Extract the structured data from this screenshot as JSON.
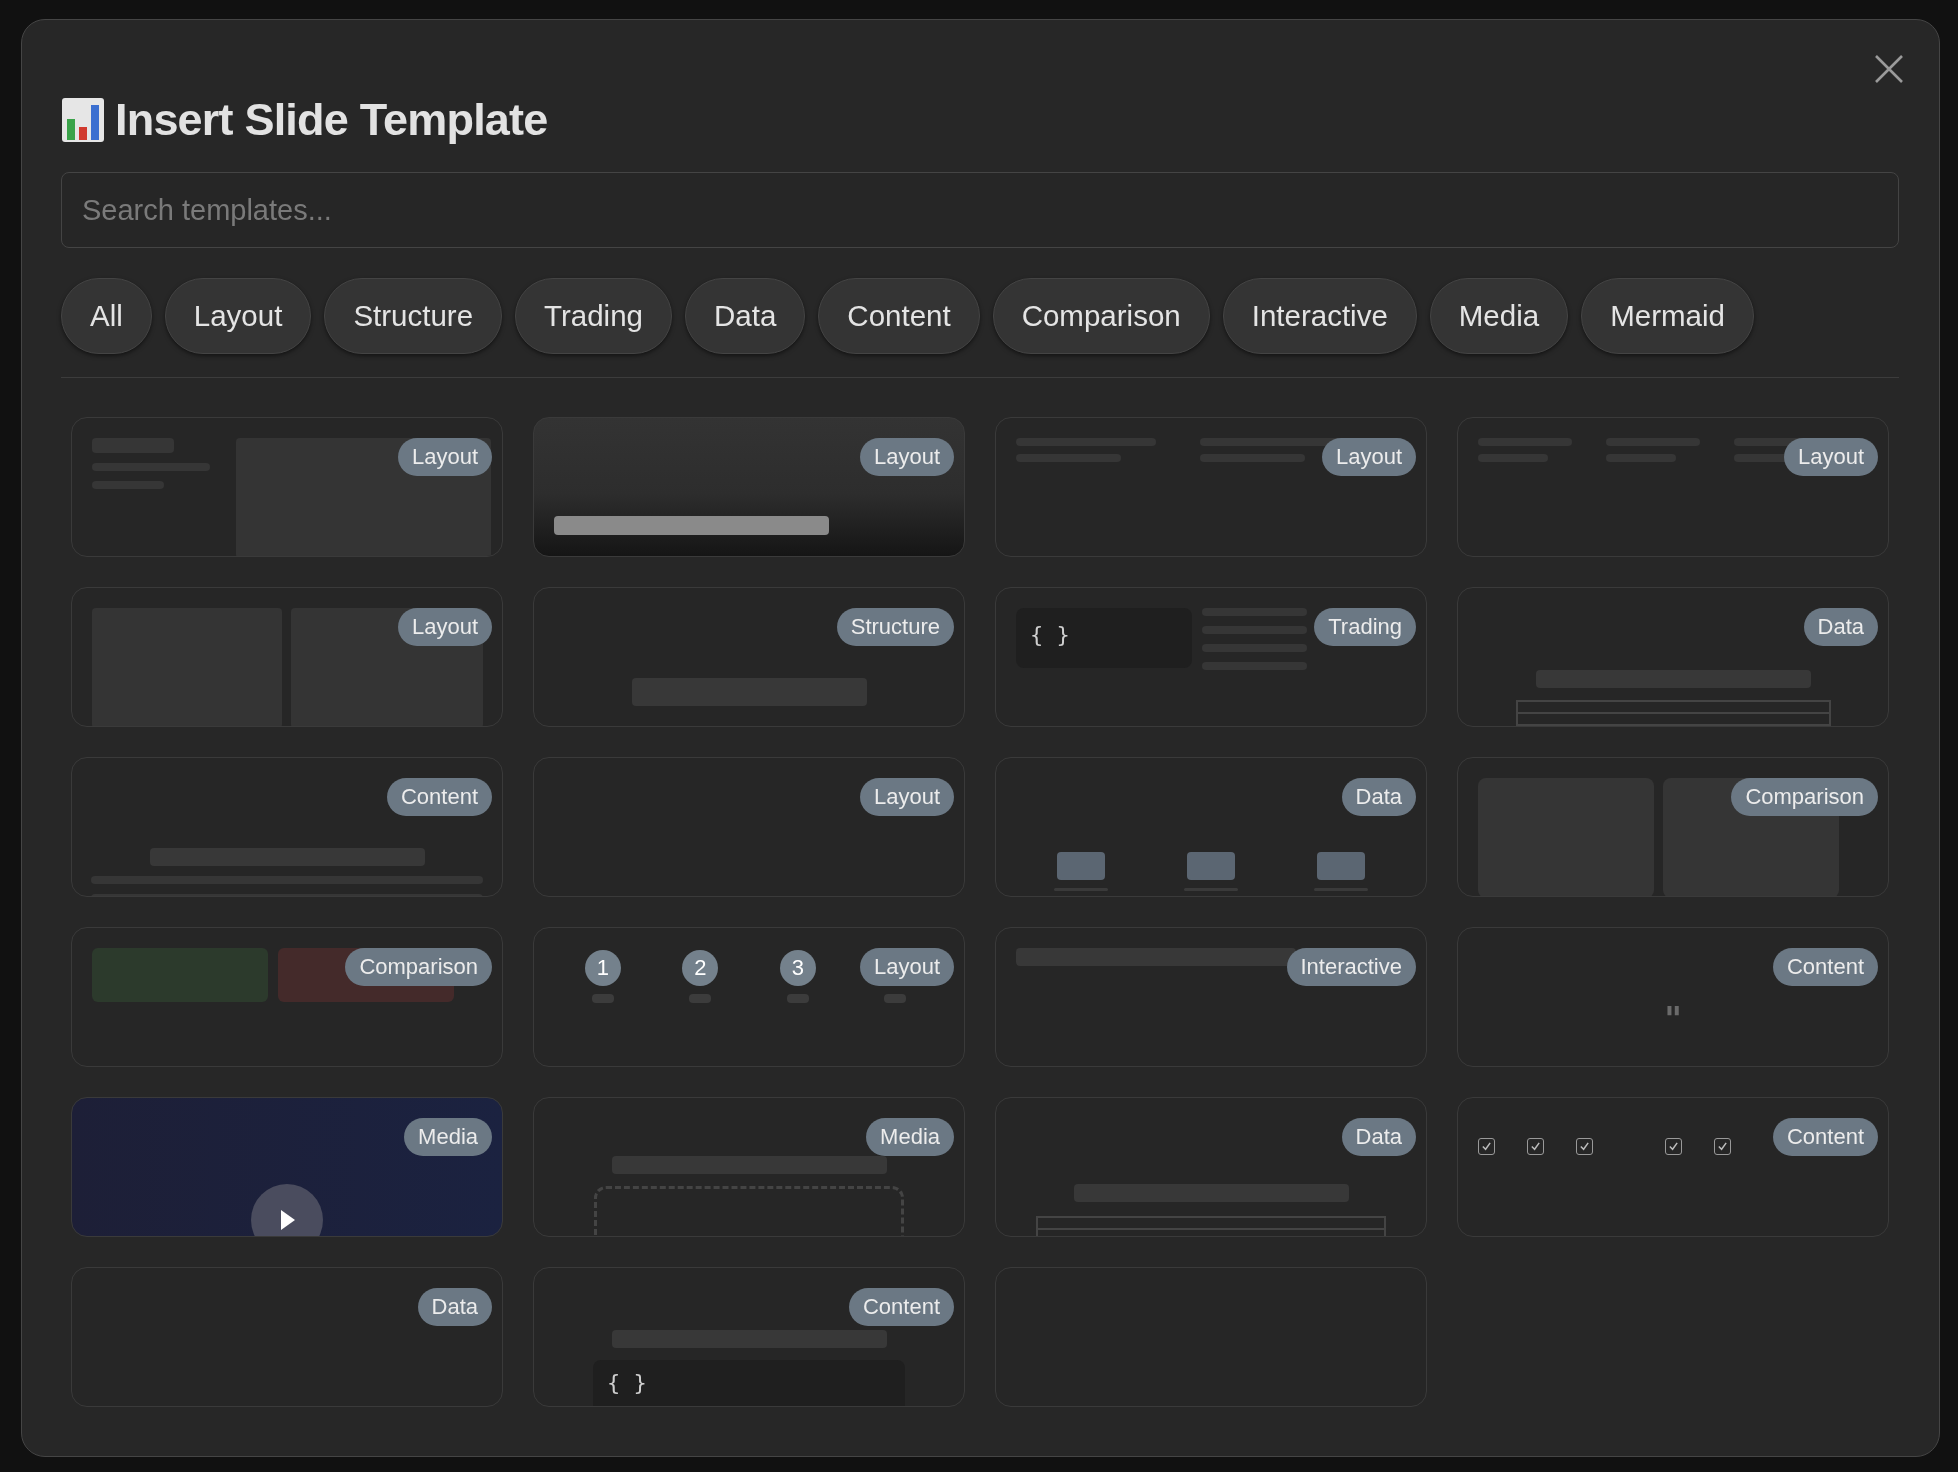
{
  "dialog": {
    "title": "Insert Slide Template"
  },
  "search": {
    "placeholder": "Search templates..."
  },
  "filters": [
    {
      "label": "All",
      "selected": false
    },
    {
      "label": "Layout",
      "selected": false
    },
    {
      "label": "Structure",
      "selected": false
    },
    {
      "label": "Trading",
      "selected": false
    },
    {
      "label": "Data",
      "selected": false
    },
    {
      "label": "Content",
      "selected": false
    },
    {
      "label": "Comparison",
      "selected": false
    },
    {
      "label": "Interactive",
      "selected": false
    },
    {
      "label": "Media",
      "selected": false
    },
    {
      "label": "Mermaid",
      "selected": false
    }
  ],
  "templates": [
    {
      "kind": "sidebar",
      "badge": "Layout"
    },
    {
      "kind": "hero",
      "badge": "Layout"
    },
    {
      "kind": "columns2",
      "badge": "Layout"
    },
    {
      "kind": "columns3",
      "badge": "Layout"
    },
    {
      "kind": "split",
      "badge": "Layout"
    },
    {
      "kind": "section",
      "badge": "Structure"
    },
    {
      "kind": "code-lines",
      "badge": "Trading",
      "code": "{ }"
    },
    {
      "kind": "title-table",
      "badge": "Data"
    },
    {
      "kind": "text",
      "badge": "Content"
    },
    {
      "kind": "blank",
      "badge": "Layout"
    },
    {
      "kind": "bars",
      "badge": "Data"
    },
    {
      "kind": "panels",
      "badge": "Comparison"
    },
    {
      "kind": "pros-cons",
      "badge": "Comparison"
    },
    {
      "kind": "steps",
      "badge": "Layout",
      "steps": [
        "1",
        "2",
        "3"
      ]
    },
    {
      "kind": "progress",
      "badge": "Interactive"
    },
    {
      "kind": "quote",
      "badge": "Content",
      "mark": "\""
    },
    {
      "kind": "video",
      "badge": "Media"
    },
    {
      "kind": "dropzone",
      "badge": "Media"
    },
    {
      "kind": "table",
      "badge": "Data"
    },
    {
      "kind": "checklist",
      "badge": "Content"
    },
    {
      "kind": "blank",
      "badge": "Data"
    },
    {
      "kind": "code-block",
      "badge": "Content",
      "code": "{ }"
    },
    {
      "kind": "blank"
    }
  ]
}
